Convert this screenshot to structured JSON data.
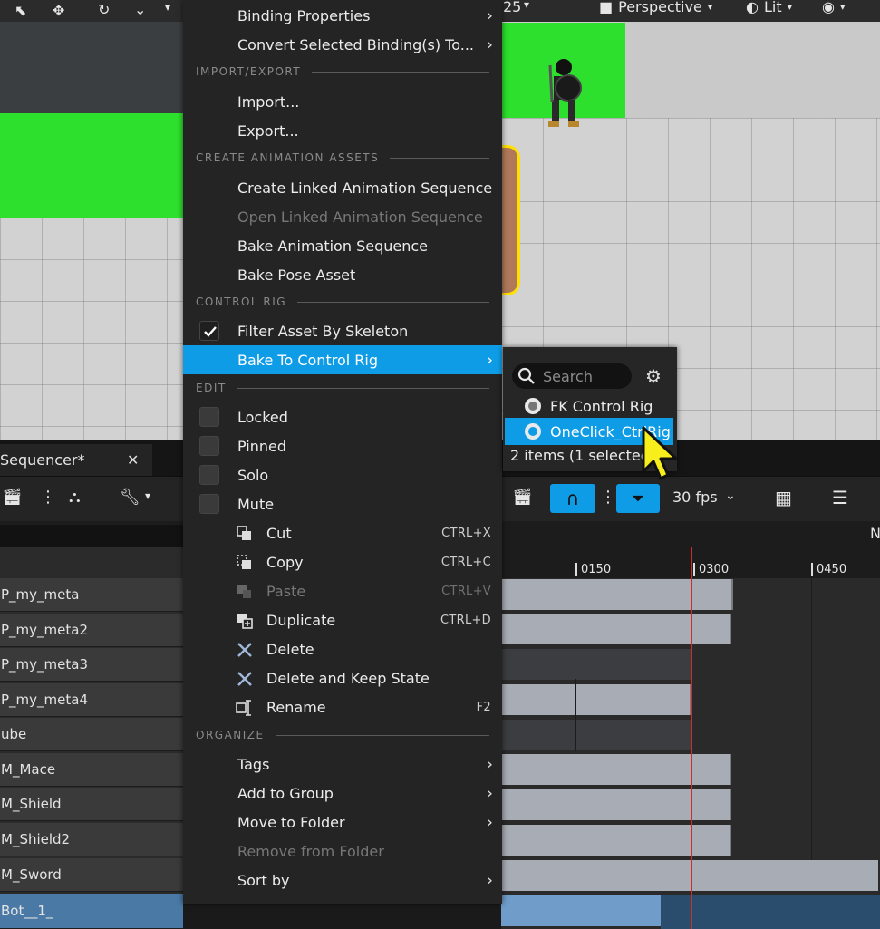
{
  "viewport": {
    "perspective_label": "Perspective",
    "lit_label": "Lit",
    "partial_number": "25"
  },
  "context_menu": {
    "items_top": [
      {
        "label": "Binding Properties"
      },
      {
        "label": "Convert Selected Binding(s) To..."
      }
    ],
    "sections": {
      "import_export": "IMPORT/EXPORT",
      "create_animation_assets": "CREATE ANIMATION ASSETS",
      "control_rig": "CONTROL RIG",
      "edit": "EDIT",
      "organize": "ORGANIZE"
    },
    "import_export": [
      {
        "label": "Import..."
      },
      {
        "label": "Export..."
      }
    ],
    "animation_assets": [
      {
        "label": "Create Linked Animation Sequence"
      },
      {
        "label": "Open Linked Animation Sequence"
      },
      {
        "label": "Bake Animation Sequence"
      },
      {
        "label": "Bake Pose Asset"
      }
    ],
    "control_rig": [
      {
        "label": "Filter Asset By Skeleton"
      },
      {
        "label": "Bake To Control Rig"
      }
    ],
    "edit_toggles": [
      {
        "label": "Locked"
      },
      {
        "label": "Pinned"
      },
      {
        "label": "Solo"
      },
      {
        "label": "Mute"
      }
    ],
    "edit_actions": [
      {
        "label": "Cut",
        "shortcut": "CTRL+X"
      },
      {
        "label": "Copy",
        "shortcut": "CTRL+C"
      },
      {
        "label": "Paste",
        "shortcut": "CTRL+V"
      },
      {
        "label": "Duplicate",
        "shortcut": "CTRL+D"
      },
      {
        "label": "Delete",
        "shortcut": ""
      },
      {
        "label": "Delete and Keep State",
        "shortcut": ""
      },
      {
        "label": "Rename",
        "shortcut": "F2"
      }
    ],
    "organize": [
      {
        "label": "Tags"
      },
      {
        "label": "Add to Group"
      },
      {
        "label": "Move to Folder"
      },
      {
        "label": "Remove from Folder"
      },
      {
        "label": "Sort by"
      }
    ]
  },
  "submenu": {
    "search_placeholder": "Search",
    "items": [
      {
        "label": "FK Control Rig"
      },
      {
        "label": "OneClick_CtrlRig"
      }
    ],
    "status": "2 items (1 selected)"
  },
  "sequencer": {
    "tab_label": "Sequencer*",
    "fps_label": "30 fps",
    "timeline_ticks": [
      "0150",
      "0300",
      "0450"
    ],
    "tracks": [
      {
        "label": "P_my_meta"
      },
      {
        "label": "P_my_meta2"
      },
      {
        "label": "P_my_meta3"
      },
      {
        "label": "P_my_meta4"
      },
      {
        "label": "ube"
      },
      {
        "label": "M_Mace"
      },
      {
        "label": "M_Shield"
      },
      {
        "label": "M_Shield2"
      },
      {
        "label": "M_Sword"
      },
      {
        "label": "Bot__1_"
      }
    ],
    "header_partial": "N"
  },
  "colors": {
    "highlight": "#0f9ce6",
    "menu_bg": "#242424",
    "green_wall": "#2ee02e"
  }
}
